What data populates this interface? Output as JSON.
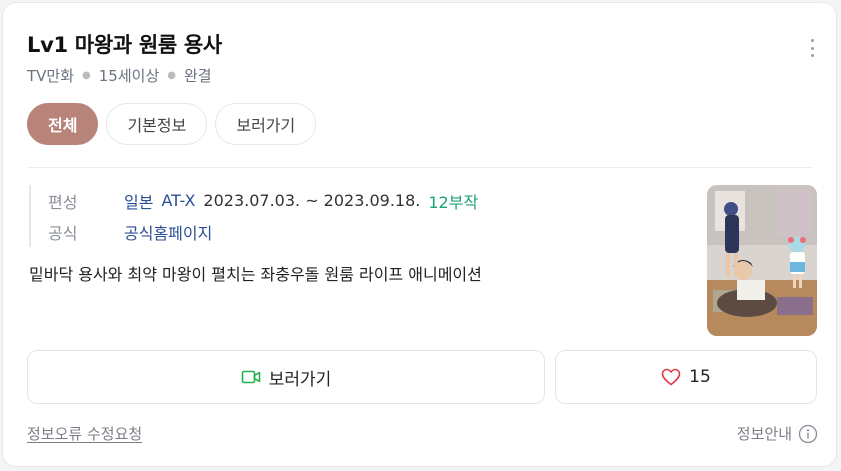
{
  "title": "Lv1 마왕과 원룸 용사",
  "meta": [
    "TV만화",
    "15세이상",
    "완결"
  ],
  "tabs": [
    {
      "label": "전체",
      "active": true
    },
    {
      "label": "기본정보",
      "active": false
    },
    {
      "label": "보러가기",
      "active": false
    }
  ],
  "info": {
    "broadcast_label": "편성",
    "country": "일본",
    "channel": "AT-X",
    "period": "2023.07.03. ~ 2023.09.18.",
    "episodes": "12부작",
    "official_label": "공식",
    "homepage": "공식홈페이지"
  },
  "description": "밑바닥 용사와 최약 마왕이 펼치는 좌충우돌 원룸 라이프 애니메이션",
  "poster_icon": "anime-poster-image",
  "buttons": {
    "watch": "보러가기",
    "like_count": "15"
  },
  "footer": {
    "report": "정보오류 수정요청",
    "info_guide": "정보안내"
  },
  "colors": {
    "accent": "#b8847a",
    "link_blue": "#2b4f96",
    "green": "#1ea07a",
    "heart": "#e0394a"
  }
}
